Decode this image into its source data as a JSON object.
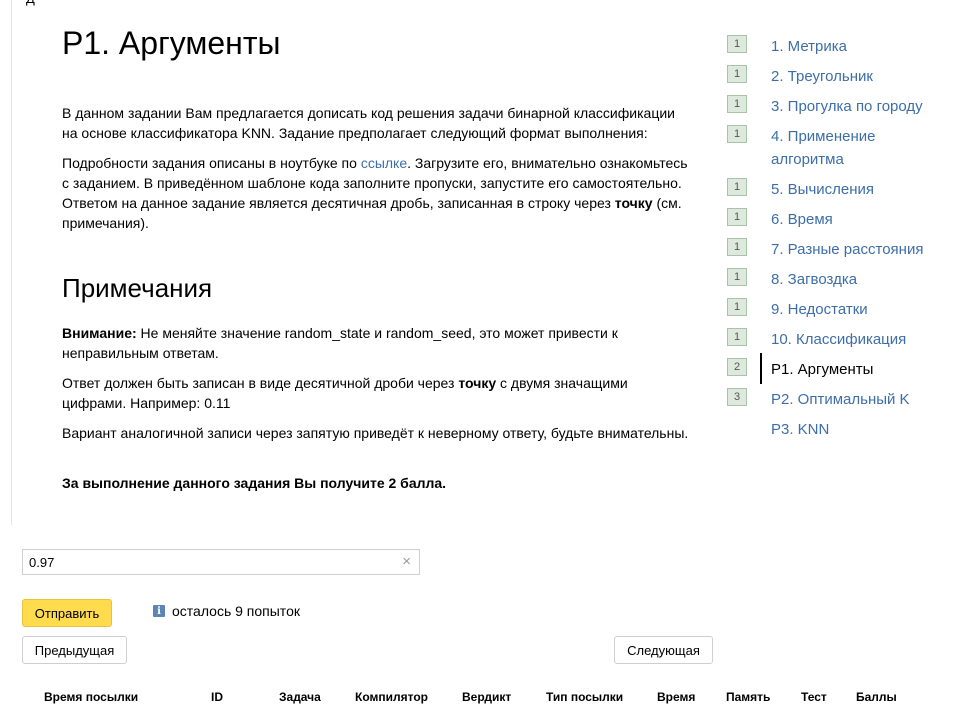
{
  "corner_text": "Д",
  "page": {
    "title": "P1. Аргументы",
    "intro": "В данном задании Вам предлагается дописать код решения задачи бинарной классификации на основе классификатора KNN. Задание предполагает следующий формат выполнения:",
    "details_before": "Подробности задания описаны в ноутбуке по ",
    "details_link": "ссылке",
    "details_after_1": ". Загрузите его, внимательно ознакомьтесь с заданием. В приведённом шаблоне кода заполните пропуски, запустите его самостоятельно. Ответом на данное задание является десятичная дробь, записанная в строку через ",
    "details_bold": "точку",
    "details_after_2": " (см. примечания).",
    "notes_heading": "Примечания",
    "warning_bold": "Внимание:",
    "warning_text": " Не меняйте значение random_state и random_seed, это может привести к неправильным ответам.",
    "format_before": "Ответ должен быть записан в виде десятичной дроби через ",
    "format_bold": "точку",
    "format_after": " с двумя значащими цифрами. Например: 0.11",
    "comma_note": "Вариант аналогичной записи через запятую приведёт к неверному ответу, будьте внимательны.",
    "points": "За выполнение данного задания Вы получите 2 балла."
  },
  "form": {
    "answer_value": "0.97",
    "clear_icon": "×",
    "submit_label": "Отправить",
    "attempts_icon": "i",
    "attempts_text": "осталось 9 попыток",
    "prev_label": "Предыдущая",
    "next_label": "Следующая"
  },
  "table_headers": [
    "Время посылки",
    "ID",
    "Задача",
    "Компилятор",
    "Вердикт",
    "Тип посылки",
    "Время",
    "Память",
    "Тест",
    "Баллы"
  ],
  "nav": [
    {
      "badge": "1",
      "label": "1. Метрика"
    },
    {
      "badge": "1",
      "label": "2. Треугольник"
    },
    {
      "badge": "1",
      "label": "3. Прогулка по городу"
    },
    {
      "badge": "1",
      "label": "4. Применение алгоритма"
    },
    {
      "badge": "1",
      "label": "5. Вычисления"
    },
    {
      "badge": "1",
      "label": "6. Время"
    },
    {
      "badge": "1",
      "label": "7. Разные расстояния"
    },
    {
      "badge": "1",
      "label": "8. Загвоздка"
    },
    {
      "badge": "1",
      "label": "9. Недостатки"
    },
    {
      "badge": "1",
      "label": "10. Классификация"
    },
    {
      "badge": "2",
      "label": "P1. Аргументы",
      "active": true
    },
    {
      "badge": "3",
      "label": "P2. Оптимальный K"
    },
    {
      "badge": "",
      "label": "P3. KNN"
    }
  ]
}
